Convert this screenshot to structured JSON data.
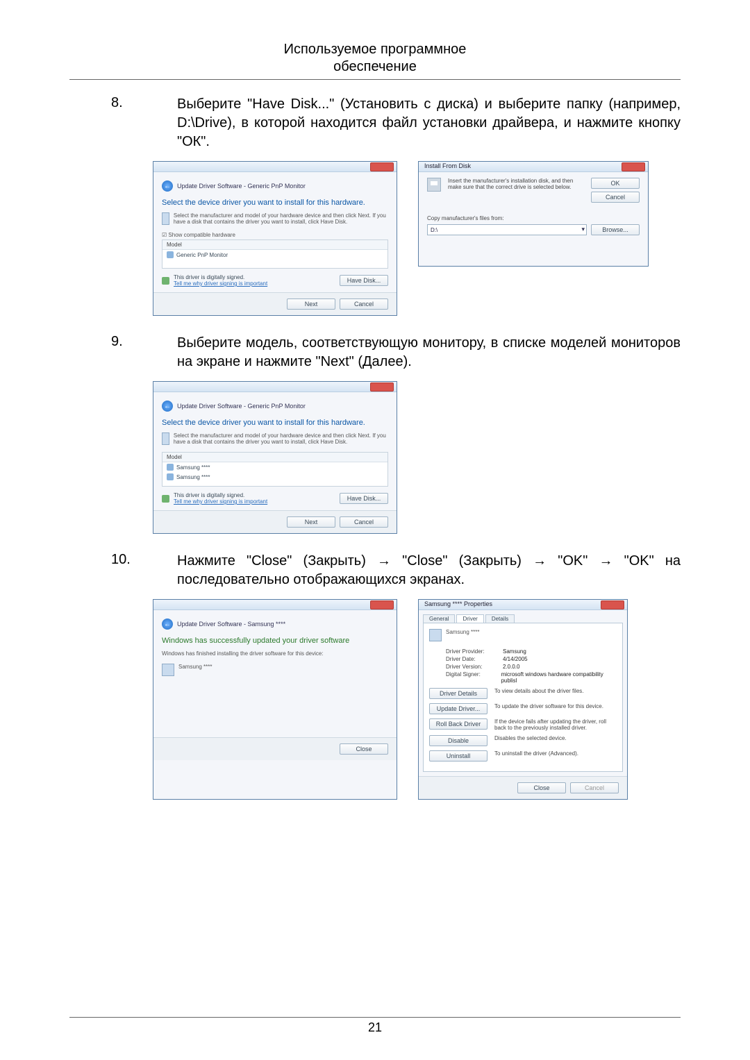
{
  "header": {
    "title": "Используемое программное",
    "subtitle": "обеспечение"
  },
  "step8": {
    "num": "8.",
    "text": "Выберите \"Have Disk...\" (Установить с диска) и выберите папку (например, D:\\Drive), в которой находится файл установки драйвера, и нажмите кнопку \"ОК\"."
  },
  "step9": {
    "num": "9.",
    "text": "Выберите модель, соответствующую монитору, в списке моделей мониторов на экране и нажмите \"Next\" (Далее)."
  },
  "step10": {
    "num": "10.",
    "text": "Нажмите \"Close\" (Закрыть) → \"Close\" (Закрыть) → \"OK\" → \"OK\" на последовательно отображающихся экранах."
  },
  "dlg1": {
    "crumb": "Update Driver Software - Generic PnP Monitor",
    "heading": "Select the device driver you want to install for this hardware.",
    "hint": "Select the manufacturer and model of your hardware device and then click Next. If you have a disk that contains the driver you want to install, click Have Disk.",
    "chk": "Show compatible hardware",
    "model_hdr": "Model",
    "model_row": "Generic PnP Monitor",
    "signed": "This driver is digitally signed.",
    "signed_link": "Tell me why driver signing is important",
    "have_disk": "Have Disk...",
    "next": "Next",
    "cancel": "Cancel",
    "back_glyph": "←"
  },
  "dlg2": {
    "title": "Install From Disk",
    "hint": "Insert the manufacturer's installation disk, and then make sure that the correct drive is selected below.",
    "ok": "OK",
    "cancel": "Cancel",
    "copy_lbl": "Copy manufacturer's files from:",
    "drive": "D:\\",
    "browse": "Browse...",
    "arrow": "▾"
  },
  "dlg3": {
    "crumb": "Update Driver Software - Generic PnP Monitor",
    "heading": "Select the device driver you want to install for this hardware.",
    "hint": "Select the manufacturer and model of your hardware device and then click Next. If you have a disk that contains the driver you want to install, click Have Disk.",
    "model_hdr": "Model",
    "row1": "Samsung ****",
    "row2": "Samsung ****",
    "signed": "This driver is digitally signed.",
    "signed_link": "Tell me why driver signing is important",
    "have_disk": "Have Disk...",
    "next": "Next",
    "cancel": "Cancel",
    "back_glyph": "←"
  },
  "dlg4": {
    "crumb": "Update Driver Software - Samsung ****",
    "heading": "Windows has successfully updated your driver software",
    "sub": "Windows has finished installing the driver software for this device:",
    "device": "Samsung ****",
    "close": "Close",
    "back_glyph": "←"
  },
  "dlg5": {
    "title": "Samsung **** Properties",
    "tab_general": "General",
    "tab_driver": "Driver",
    "tab_details": "Details",
    "device": "Samsung ****",
    "rows": {
      "provider_k": "Driver Provider:",
      "provider_v": "Samsung",
      "date_k": "Driver Date:",
      "date_v": "4/14/2005",
      "version_k": "Driver Version:",
      "version_v": "2.0.0.0",
      "signer_k": "Digital Signer:",
      "signer_v": "microsoft windows hardware compatibility publisl"
    },
    "btns": {
      "details": "Driver Details",
      "details_d": "To view details about the driver files.",
      "update": "Update Driver...",
      "update_d": "To update the driver software for this device.",
      "rollback": "Roll Back Driver",
      "rollback_d": "If the device fails after updating the driver, roll back to the previously installed driver.",
      "disable": "Disable",
      "disable_d": "Disables the selected device.",
      "uninstall": "Uninstall",
      "uninstall_d": "To uninstall the driver (Advanced)."
    },
    "close": "Close",
    "cancel": "Cancel"
  },
  "page_number": "21"
}
